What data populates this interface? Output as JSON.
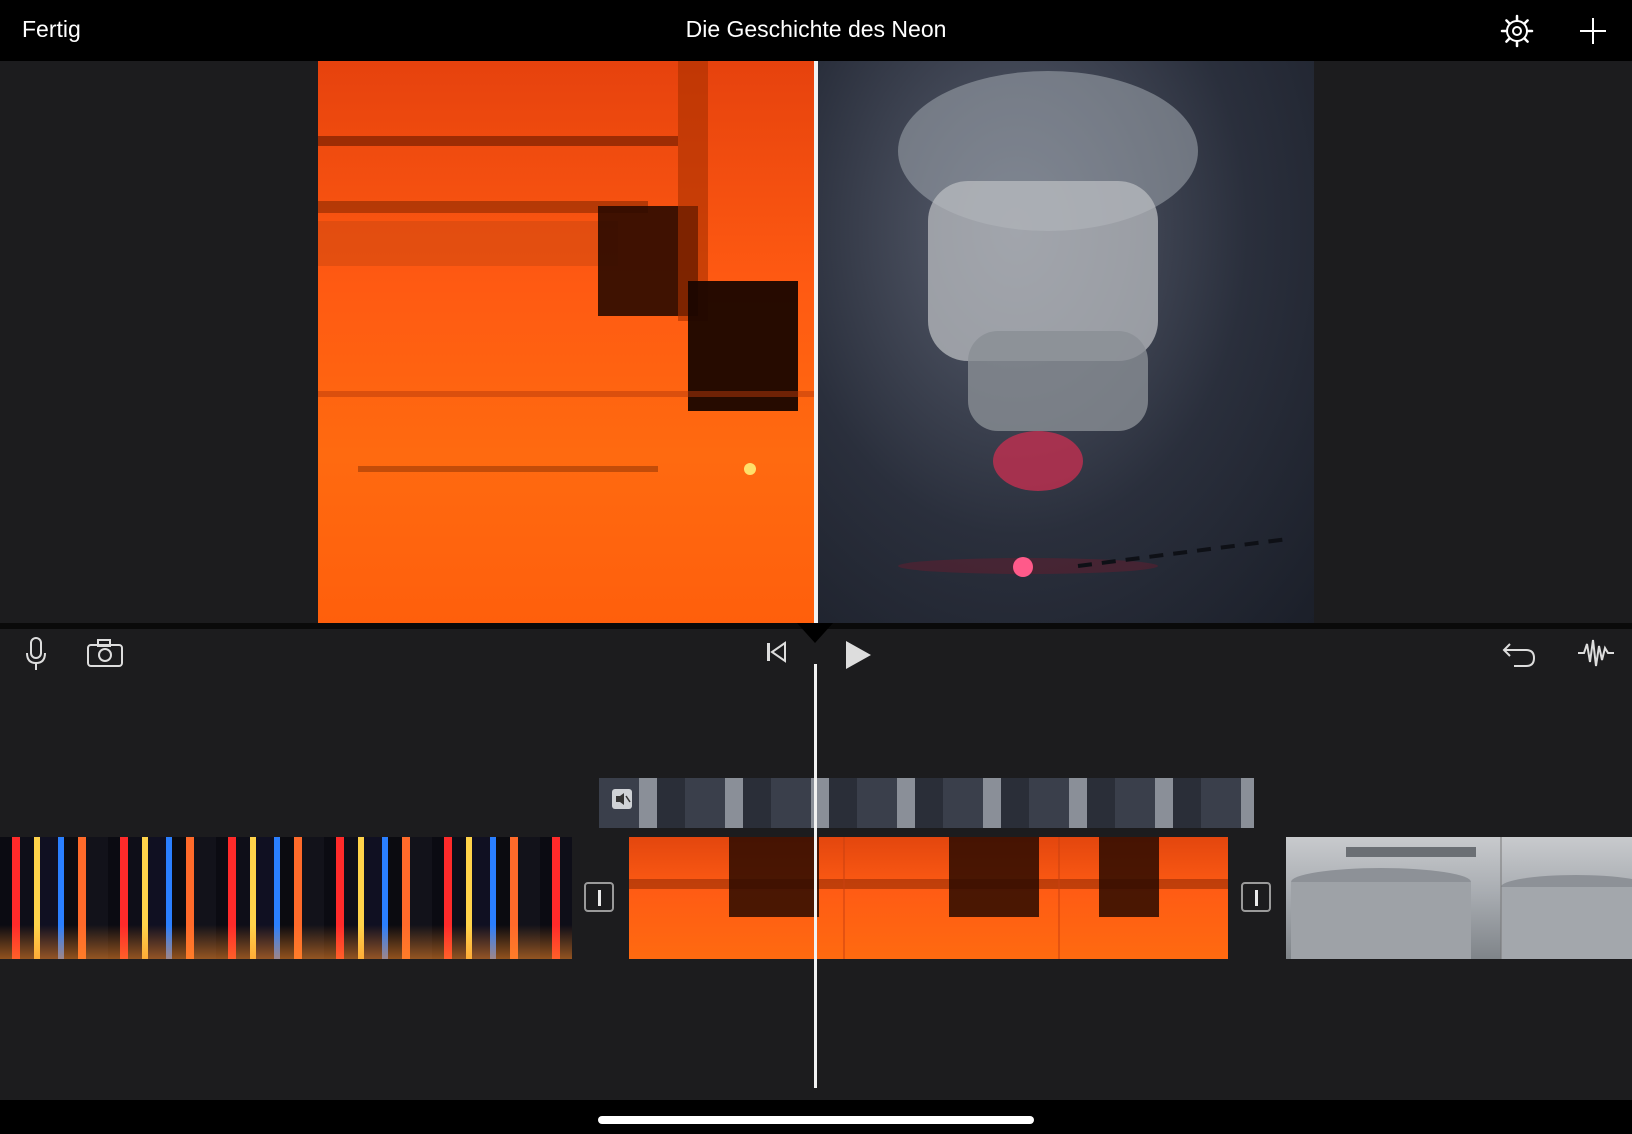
{
  "topbar": {
    "done_label": "Fertig",
    "project_title": "Die Geschichte des Neon"
  },
  "icons": {
    "settings": "gear-icon",
    "add": "plus-icon",
    "microphone": "microphone-icon",
    "camera": "camera-icon",
    "skip_to_start": "skip-to-start-icon",
    "play": "play-icon",
    "undo": "undo-icon",
    "audio_waveform": "audio-waveform-icon",
    "mute": "speaker-muted-icon",
    "transition": "transition-icon"
  },
  "colors": {
    "topbar": "#000000",
    "background": "#1c1c1e",
    "playhead": "#f2f2f2",
    "laser_clip": "#ff5c14"
  }
}
